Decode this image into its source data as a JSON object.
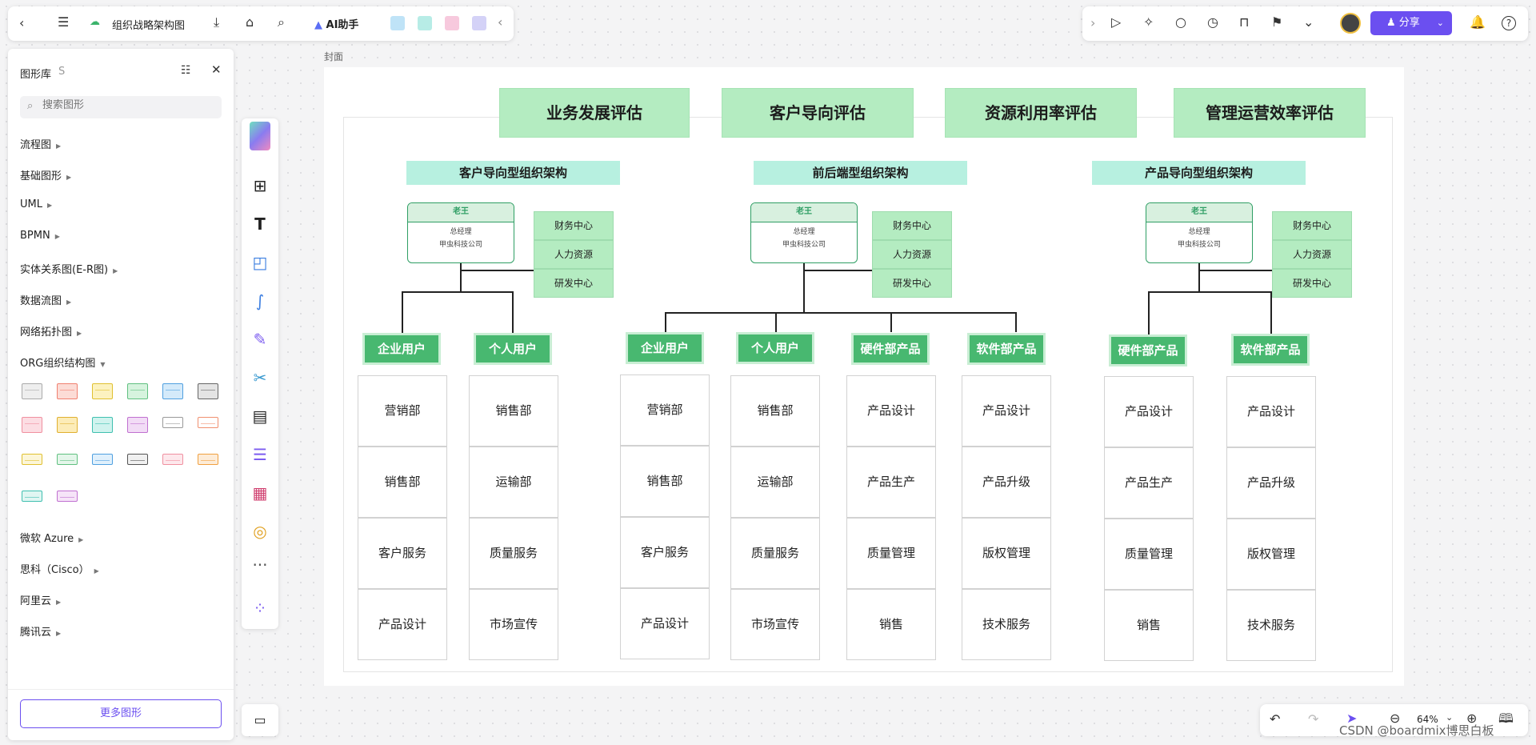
{
  "toolbar": {
    "doc_title": "组织战略架构图",
    "ai_label": "AI助手",
    "share_label": "分享"
  },
  "library": {
    "title": "图形库",
    "shortcut": "S",
    "search_placeholder": "搜索图形",
    "more_label": "更多图形",
    "categories": [
      "流程图",
      "基础图形",
      "UML",
      "BPMN",
      "实体关系图(E-R图)",
      "数据流图",
      "网络拓扑图",
      "ORG组织结构图",
      "微软 Azure",
      "思科（Cisco）",
      "阿里云",
      "腾讯云"
    ]
  },
  "frame_label": "封面",
  "zoom": "64%",
  "watermark": "CSDN @boardmix博思白板",
  "diagram": {
    "headers": [
      "业务发展评估",
      "客户导向评估",
      "资源利用率评估",
      "管理运营效率评估"
    ],
    "groups": [
      {
        "title": "客户导向型组织架构",
        "boss": {
          "name": "老王",
          "role": "总经理",
          "company": "甲虫科技公司"
        },
        "centers": [
          "财务中心",
          "人力资源",
          "研发中心"
        ],
        "units": [
          {
            "name": "企业用户",
            "depts": [
              "营销部",
              "销售部",
              "客户服务",
              "产品设计"
            ]
          },
          {
            "name": "个人用户",
            "depts": [
              "销售部",
              "运输部",
              "质量服务",
              "市场宣传"
            ]
          }
        ]
      },
      {
        "title": "前后端型组织架构",
        "boss": {
          "name": "老王",
          "role": "总经理",
          "company": "甲虫科技公司"
        },
        "centers": [
          "财务中心",
          "人力资源",
          "研发中心"
        ],
        "units": [
          {
            "name": "企业用户",
            "depts": [
              "营销部",
              "销售部",
              "客户服务",
              "产品设计"
            ]
          },
          {
            "name": "个人用户",
            "depts": [
              "销售部",
              "运输部",
              "质量服务",
              "市场宣传"
            ]
          },
          {
            "name": "硬件部产品",
            "depts": [
              "产品设计",
              "产品生产",
              "质量管理",
              "销售"
            ]
          },
          {
            "name": "软件部产品",
            "depts": [
              "产品设计",
              "产品升级",
              "版权管理",
              "技术服务"
            ]
          }
        ]
      },
      {
        "title": "产品导向型组织架构",
        "boss": {
          "name": "老王",
          "role": "总经理",
          "company": "甲虫科技公司"
        },
        "centers": [
          "财务中心",
          "人力资源",
          "研发中心"
        ],
        "units": [
          {
            "name": "硬件部产品",
            "depts": [
              "产品设计",
              "产品生产",
              "质量管理",
              "销售"
            ]
          },
          {
            "name": "软件部产品",
            "depts": [
              "产品设计",
              "产品升级",
              "版权管理",
              "技术服务"
            ]
          }
        ]
      }
    ]
  }
}
